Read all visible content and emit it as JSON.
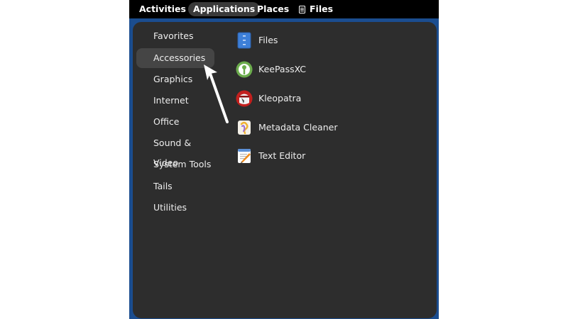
{
  "topbar": {
    "activities": "Activities",
    "applications": "Applications",
    "places": "Places",
    "files": "Files",
    "files_icon": "file-cabinet-icon"
  },
  "menu": {
    "categories": [
      {
        "label": "Favorites"
      },
      {
        "label": "Accessories",
        "selected": true
      },
      {
        "label": "Graphics"
      },
      {
        "label": "Internet"
      },
      {
        "label": "Office"
      },
      {
        "label": "Sound & Video"
      },
      {
        "label": "System Tools"
      },
      {
        "label": "Tails"
      },
      {
        "label": "Utilities"
      }
    ],
    "apps": [
      {
        "label": "Files",
        "icon": "files-icon"
      },
      {
        "label": "KeePassXC",
        "icon": "keepassxc-icon"
      },
      {
        "label": "Kleopatra",
        "icon": "kleopatra-icon"
      },
      {
        "label": "Metadata Cleaner",
        "icon": "metadata-cleaner-icon"
      },
      {
        "label": "Text Editor",
        "icon": "text-editor-icon"
      }
    ]
  },
  "colors": {
    "desktop": "#1b4d8f",
    "topbar": "#000000",
    "menu_bg": "#2d2d2d",
    "selected_bg": "#454545",
    "pointer": "#ffffff"
  }
}
